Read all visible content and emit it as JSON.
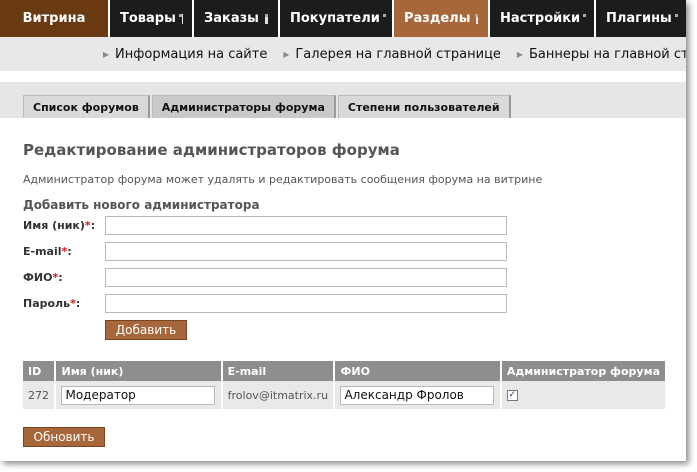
{
  "topnav": {
    "items": [
      "Витрина",
      "Товары",
      "Заказы",
      "Покупатели",
      "Разделы",
      "Настройки",
      "Плагины"
    ]
  },
  "subnav": {
    "items": [
      "Информация на сайте",
      "Галерея на главной странице",
      "Баннеры на главной стра"
    ]
  },
  "tabs": [
    "Список форумов",
    "Администраторы форума",
    "Степени пользователей"
  ],
  "page": {
    "title": "Редактирование администраторов форума",
    "description": "Администратор форума может удалять и редактировать сообщения форума на витрине",
    "add_heading": "Добавить нового администратора"
  },
  "form": {
    "fields": [
      {
        "label": "Имя (ник)",
        "required": "*",
        "colon": ":"
      },
      {
        "label": "E-mail",
        "required": "*",
        "colon": ":"
      },
      {
        "label": "ФИО",
        "required": "*",
        "colon": ":"
      },
      {
        "label": "Пароль",
        "required": "*",
        "colon": ":"
      }
    ],
    "add_button": "Добавить"
  },
  "table": {
    "headers": [
      "ID",
      "Имя (ник)",
      "E-mail",
      "ФИО",
      "Администратор форума"
    ],
    "rows": [
      {
        "id": "272",
        "nick": "Модератор",
        "email": "frolov@itmatrix.ru",
        "fio": "Александр Фролов",
        "admin_checked": "✓"
      }
    ]
  },
  "update_button": "Обновить",
  "colors": {
    "brand": "#6a3a12",
    "accent": "#a8673a",
    "topbar": "#1c1c1c",
    "required": "#dd1111"
  }
}
